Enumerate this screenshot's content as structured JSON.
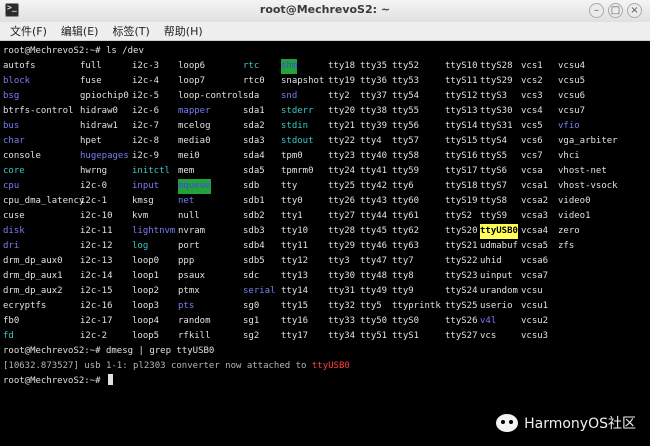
{
  "window": {
    "title": "root@MechrevoS2: ~"
  },
  "menu": [
    "文件(F)",
    "编辑(E)",
    "标签(T)",
    "帮助(H)"
  ],
  "terminal": {
    "prompt": "root@MechrevoS2:~#",
    "command1": "ls /dev",
    "ls_rows": [
      [
        [
          "autofs",
          ""
        ],
        [
          "full",
          ""
        ],
        [
          "i2c-3",
          ""
        ],
        [
          "loop6",
          ""
        ],
        [
          "rtc",
          "c"
        ],
        [
          "shm",
          "bgg"
        ],
        [
          "tty18",
          ""
        ],
        [
          "tty35",
          ""
        ],
        [
          "tty52",
          ""
        ],
        [
          "ttyS10",
          ""
        ],
        [
          "ttyS28",
          ""
        ],
        [
          "vcs1",
          ""
        ],
        [
          "vcsu4",
          ""
        ]
      ],
      [
        [
          "block",
          "d"
        ],
        [
          "fuse",
          ""
        ],
        [
          "i2c-4",
          ""
        ],
        [
          "loop7",
          ""
        ],
        [
          "rtc0",
          ""
        ],
        [
          "snapshot",
          ""
        ],
        [
          "tty19",
          ""
        ],
        [
          "tty36",
          ""
        ],
        [
          "tty53",
          ""
        ],
        [
          "ttyS11",
          ""
        ],
        [
          "ttyS29",
          ""
        ],
        [
          "vcs2",
          ""
        ],
        [
          "vcsu5",
          ""
        ]
      ],
      [
        [
          "bsg",
          "d"
        ],
        [
          "gpiochip0",
          ""
        ],
        [
          "i2c-5",
          ""
        ],
        [
          "loop-control",
          ""
        ],
        [
          "sda",
          ""
        ],
        [
          "snd",
          "d"
        ],
        [
          "tty2",
          ""
        ],
        [
          "tty37",
          ""
        ],
        [
          "tty54",
          ""
        ],
        [
          "ttyS12",
          ""
        ],
        [
          "ttyS3",
          ""
        ],
        [
          "vcs3",
          ""
        ],
        [
          "vcsu6",
          ""
        ]
      ],
      [
        [
          "btrfs-control",
          ""
        ],
        [
          "hidraw0",
          ""
        ],
        [
          "i2c-6",
          ""
        ],
        [
          "mapper",
          "d"
        ],
        [
          "sda1",
          ""
        ],
        [
          "stderr",
          "c"
        ],
        [
          "tty20",
          ""
        ],
        [
          "tty38",
          ""
        ],
        [
          "tty55",
          ""
        ],
        [
          "ttyS13",
          ""
        ],
        [
          "ttyS30",
          ""
        ],
        [
          "vcs4",
          ""
        ],
        [
          "vcsu7",
          ""
        ]
      ],
      [
        [
          "bus",
          "d"
        ],
        [
          "hidraw1",
          ""
        ],
        [
          "i2c-7",
          ""
        ],
        [
          "mcelog",
          ""
        ],
        [
          "sda2",
          ""
        ],
        [
          "stdin",
          "c"
        ],
        [
          "tty21",
          ""
        ],
        [
          "tty39",
          ""
        ],
        [
          "tty56",
          ""
        ],
        [
          "ttyS14",
          ""
        ],
        [
          "ttyS31",
          ""
        ],
        [
          "vcs5",
          ""
        ],
        [
          "vfio",
          "d"
        ]
      ],
      [
        [
          "char",
          "d"
        ],
        [
          "hpet",
          ""
        ],
        [
          "i2c-8",
          ""
        ],
        [
          "media0",
          ""
        ],
        [
          "sda3",
          ""
        ],
        [
          "stdout",
          "c"
        ],
        [
          "tty22",
          ""
        ],
        [
          "tty4",
          ""
        ],
        [
          "tty57",
          ""
        ],
        [
          "ttyS15",
          ""
        ],
        [
          "ttyS4",
          ""
        ],
        [
          "vcs6",
          ""
        ],
        [
          "vga_arbiter",
          ""
        ]
      ],
      [
        [
          "console",
          ""
        ],
        [
          "hugepages",
          "d"
        ],
        [
          "i2c-9",
          ""
        ],
        [
          "mei0",
          ""
        ],
        [
          "sda4",
          ""
        ],
        [
          "tpm0",
          ""
        ],
        [
          "tty23",
          ""
        ],
        [
          "tty40",
          ""
        ],
        [
          "tty58",
          ""
        ],
        [
          "ttyS16",
          ""
        ],
        [
          "ttyS5",
          ""
        ],
        [
          "vcs7",
          ""
        ],
        [
          "vhci",
          ""
        ]
      ],
      [
        [
          "core",
          "c"
        ],
        [
          "hwrng",
          ""
        ],
        [
          "initctl",
          "c"
        ],
        [
          "mem",
          ""
        ],
        [
          "sda5",
          ""
        ],
        [
          "tpmrm0",
          ""
        ],
        [
          "tty24",
          ""
        ],
        [
          "tty41",
          ""
        ],
        [
          "tty59",
          ""
        ],
        [
          "ttyS17",
          ""
        ],
        [
          "ttyS6",
          ""
        ],
        [
          "vcsa",
          ""
        ],
        [
          "vhost-net",
          ""
        ]
      ],
      [
        [
          "cpu",
          "d"
        ],
        [
          "i2c-0",
          ""
        ],
        [
          "input",
          "d"
        ],
        [
          "mqueue",
          "bgg"
        ],
        [
          "sdb",
          ""
        ],
        [
          "tty",
          ""
        ],
        [
          "tty25",
          ""
        ],
        [
          "tty42",
          ""
        ],
        [
          "tty6",
          ""
        ],
        [
          "ttyS18",
          ""
        ],
        [
          "ttyS7",
          ""
        ],
        [
          "vcsa1",
          ""
        ],
        [
          "vhost-vsock",
          ""
        ]
      ],
      [
        [
          "cpu_dma_latency",
          ""
        ],
        [
          "i2c-1",
          ""
        ],
        [
          "kmsg",
          ""
        ],
        [
          "net",
          "d"
        ],
        [
          "sdb1",
          ""
        ],
        [
          "tty0",
          ""
        ],
        [
          "tty26",
          ""
        ],
        [
          "tty43",
          ""
        ],
        [
          "tty60",
          ""
        ],
        [
          "ttyS19",
          ""
        ],
        [
          "ttyS8",
          ""
        ],
        [
          "vcsa2",
          ""
        ],
        [
          "video0",
          ""
        ]
      ],
      [
        [
          "cuse",
          ""
        ],
        [
          "i2c-10",
          ""
        ],
        [
          "kvm",
          ""
        ],
        [
          "null",
          ""
        ],
        [
          "sdb2",
          ""
        ],
        [
          "tty1",
          ""
        ],
        [
          "tty27",
          ""
        ],
        [
          "tty44",
          ""
        ],
        [
          "tty61",
          ""
        ],
        [
          "ttyS2",
          ""
        ],
        [
          "ttyS9",
          ""
        ],
        [
          "vcsa3",
          ""
        ],
        [
          "video1",
          ""
        ]
      ],
      [
        [
          "disk",
          "d"
        ],
        [
          "i2c-11",
          ""
        ],
        [
          "lightnvm",
          "d"
        ],
        [
          "nvram",
          ""
        ],
        [
          "sdb3",
          ""
        ],
        [
          "tty10",
          ""
        ],
        [
          "tty28",
          ""
        ],
        [
          "tty45",
          ""
        ],
        [
          "tty62",
          ""
        ],
        [
          "ttyS20",
          ""
        ],
        [
          "ttyUSB0",
          "sel"
        ],
        [
          "vcsa4",
          ""
        ],
        [
          "zero",
          ""
        ]
      ],
      [
        [
          "dri",
          "d"
        ],
        [
          "i2c-12",
          ""
        ],
        [
          "log",
          "c"
        ],
        [
          "port",
          ""
        ],
        [
          "sdb4",
          ""
        ],
        [
          "tty11",
          ""
        ],
        [
          "tty29",
          ""
        ],
        [
          "tty46",
          ""
        ],
        [
          "tty63",
          ""
        ],
        [
          "ttyS21",
          ""
        ],
        [
          "udmabuf",
          ""
        ],
        [
          "vcsa5",
          ""
        ],
        [
          "zfs",
          ""
        ]
      ],
      [
        [
          "drm_dp_aux0",
          ""
        ],
        [
          "i2c-13",
          ""
        ],
        [
          "loop0",
          ""
        ],
        [
          "ppp",
          ""
        ],
        [
          "sdb5",
          ""
        ],
        [
          "tty12",
          ""
        ],
        [
          "tty3",
          ""
        ],
        [
          "tty47",
          ""
        ],
        [
          "tty7",
          ""
        ],
        [
          "ttyS22",
          ""
        ],
        [
          "uhid",
          ""
        ],
        [
          "vcsa6",
          ""
        ]
      ],
      [
        [
          "drm_dp_aux1",
          ""
        ],
        [
          "i2c-14",
          ""
        ],
        [
          "loop1",
          ""
        ],
        [
          "psaux",
          ""
        ],
        [
          "sdc",
          ""
        ],
        [
          "tty13",
          ""
        ],
        [
          "tty30",
          ""
        ],
        [
          "tty48",
          ""
        ],
        [
          "tty8",
          ""
        ],
        [
          "ttyS23",
          ""
        ],
        [
          "uinput",
          ""
        ],
        [
          "vcsa7",
          ""
        ]
      ],
      [
        [
          "drm_dp_aux2",
          ""
        ],
        [
          "i2c-15",
          ""
        ],
        [
          "loop2",
          ""
        ],
        [
          "ptmx",
          ""
        ],
        [
          "serial",
          "d"
        ],
        [
          "tty14",
          ""
        ],
        [
          "tty31",
          ""
        ],
        [
          "tty49",
          ""
        ],
        [
          "tty9",
          ""
        ],
        [
          "ttyS24",
          ""
        ],
        [
          "urandom",
          ""
        ],
        [
          "vcsu",
          ""
        ]
      ],
      [
        [
          "ecryptfs",
          ""
        ],
        [
          "i2c-16",
          ""
        ],
        [
          "loop3",
          ""
        ],
        [
          "pts",
          "d"
        ],
        [
          "sg0",
          ""
        ],
        [
          "tty15",
          ""
        ],
        [
          "tty32",
          ""
        ],
        [
          "tty5",
          ""
        ],
        [
          "ttyprintk",
          ""
        ],
        [
          "ttyS25",
          ""
        ],
        [
          "userio",
          ""
        ],
        [
          "vcsu1",
          ""
        ]
      ],
      [
        [
          "fb0",
          ""
        ],
        [
          "i2c-17",
          ""
        ],
        [
          "loop4",
          ""
        ],
        [
          "random",
          ""
        ],
        [
          "sg1",
          ""
        ],
        [
          "tty16",
          ""
        ],
        [
          "tty33",
          ""
        ],
        [
          "tty50",
          ""
        ],
        [
          "ttyS0",
          ""
        ],
        [
          "ttyS26",
          ""
        ],
        [
          "v4l",
          "d"
        ],
        [
          "vcsu2",
          ""
        ]
      ],
      [
        [
          "fd",
          "c"
        ],
        [
          "i2c-2",
          ""
        ],
        [
          "loop5",
          ""
        ],
        [
          "rfkill",
          ""
        ],
        [
          "sg2",
          ""
        ],
        [
          "tty17",
          ""
        ],
        [
          "tty34",
          ""
        ],
        [
          "tty51",
          ""
        ],
        [
          "ttyS1",
          ""
        ],
        [
          "ttyS27",
          ""
        ],
        [
          "vcs",
          ""
        ],
        [
          "vcsu3",
          ""
        ]
      ]
    ],
    "command2": "dmesg | grep ttyUSB0",
    "dmesg_prefix": "[10632.873527] usb 1-1: pl2303 converter now attached to",
    "dmesg_highlight": "ttyUSB0"
  },
  "watermark": {
    "icon": "wechat-icon",
    "text": "HarmonyOS社区"
  }
}
